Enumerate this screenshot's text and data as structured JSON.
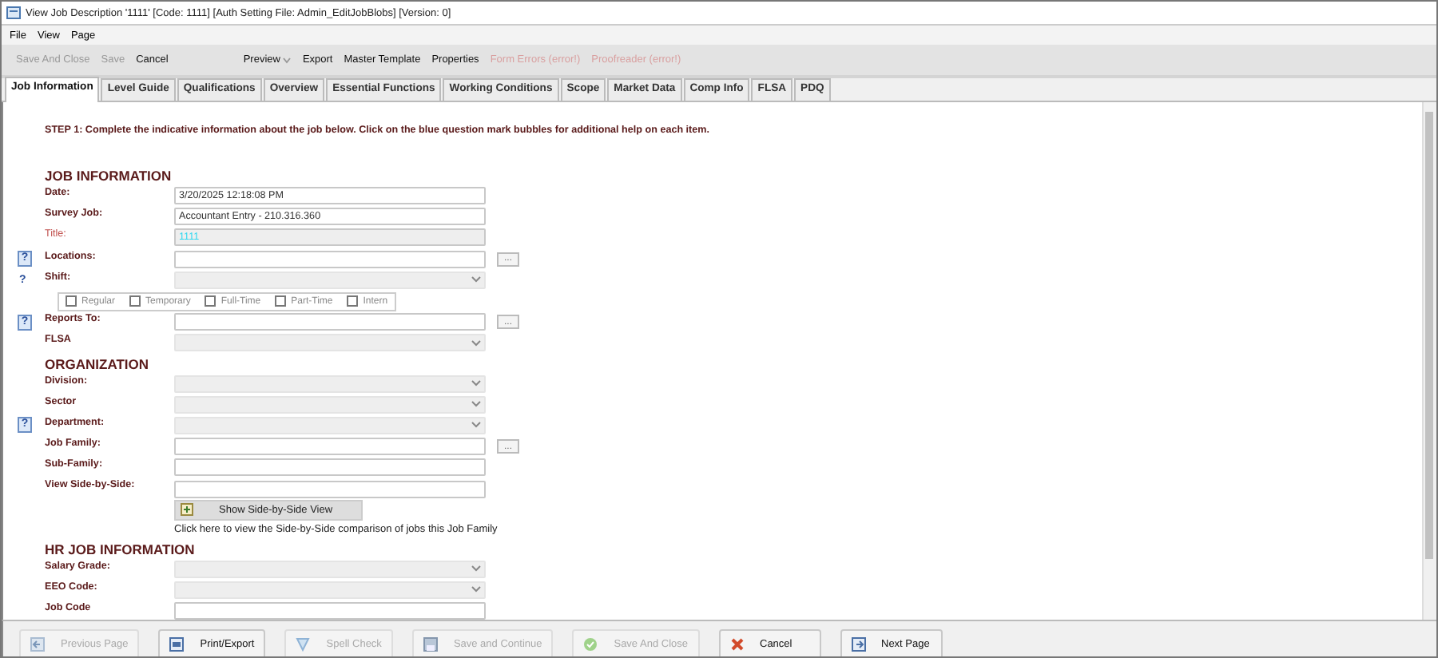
{
  "window": {
    "title": "View Job Description '1111'  [Code: 1111] [Auth Setting File: Admin_EditJobBlobs] [Version: 0]"
  },
  "menu": [
    "File",
    "View",
    "Page"
  ],
  "toolbar": [
    {
      "label": "Save And Close",
      "disabled": true,
      "kind": "plain"
    },
    {
      "label": "Save",
      "disabled": true,
      "kind": "plain"
    },
    {
      "label": "Cancel",
      "disabled": false,
      "kind": "plain"
    },
    {
      "label": "Preview",
      "disabled": false,
      "kind": "dropdown"
    },
    {
      "label": "Export",
      "disabled": false,
      "kind": "plain"
    },
    {
      "label": "Master Template",
      "disabled": false,
      "kind": "plain"
    },
    {
      "label": "Properties",
      "disabled": false,
      "kind": "plain"
    },
    {
      "label": "Form Errors (error!)",
      "disabled": true,
      "kind": "plain"
    },
    {
      "label": "Proofreader (error!)",
      "disabled": true,
      "kind": "plain"
    }
  ],
  "tabs": [
    {
      "label": "Job Information",
      "selected": true
    },
    {
      "label": "Level Guide",
      "selected": false
    },
    {
      "label": "Qualifications",
      "selected": false
    },
    {
      "label": "Overview",
      "selected": false
    },
    {
      "label": "Essential Functions",
      "selected": false
    },
    {
      "label": "Working Conditions",
      "selected": false
    },
    {
      "label": "Scope",
      "selected": false
    },
    {
      "label": "Market Data",
      "selected": false
    },
    {
      "label": "Comp Info",
      "selected": false
    },
    {
      "label": "FLSA",
      "selected": false
    },
    {
      "label": "PDQ",
      "selected": false
    }
  ],
  "instructions": "STEP 1:  Complete the indicative information about the job below.  Click on the blue question mark bubbles for additional help on each item.",
  "sections": [
    {
      "heading": "JOB INFORMATION",
      "rows": [
        {
          "kind": "text",
          "label": "Date:",
          "value": "3/20/2025 12:18:08 PM",
          "required": false
        },
        {
          "kind": "text",
          "label": "Survey Job:",
          "value": "Accountant Entry - 210.316.360",
          "required": false
        },
        {
          "kind": "readonly",
          "label": "Title:",
          "value": "1111",
          "required": true
        },
        {
          "kind": "text",
          "label": "Locations:",
          "help": {
            "kind": "bubble",
            "text": "?"
          },
          "browse": "...",
          "required": false
        },
        {
          "kind": "select",
          "label": "Shift:",
          "help": {
            "kind": "mark",
            "text": "?"
          },
          "required": false
        },
        {
          "kind": "checkboxes",
          "options": [
            {
              "label": "Regular",
              "checked": false
            },
            {
              "label": "Temporary",
              "checked": false
            },
            {
              "label": "Full-Time",
              "checked": false
            },
            {
              "label": "Part-Time",
              "checked": false
            },
            {
              "label": "Intern",
              "checked": false
            }
          ]
        },
        {
          "kind": "text",
          "label": "Reports To:",
          "help": {
            "kind": "bubble",
            "text": "?"
          },
          "browse": "...",
          "required": false
        },
        {
          "kind": "select",
          "label": "FLSA",
          "required": false
        }
      ]
    },
    {
      "heading": "ORGANIZATION",
      "rows": [
        {
          "kind": "select",
          "label": "Division:",
          "required": false
        },
        {
          "kind": "select",
          "label": "Sector",
          "required": false
        },
        {
          "kind": "select",
          "label": "Department:",
          "help": {
            "kind": "bubble",
            "text": "?"
          },
          "required": false
        },
        {
          "kind": "text",
          "label": "Job Family:",
          "browse": "...",
          "required": false
        },
        {
          "kind": "text",
          "label": "Sub-Family:",
          "required": false
        },
        {
          "kind": "text",
          "label": "View Side-by-Side:",
          "required": false
        },
        {
          "kind": "action",
          "button": "Show Side-by-Side View",
          "note": "Click here to view the Side-by-Side comparison of jobs this Job Family"
        }
      ]
    },
    {
      "heading": "HR JOB INFORMATION",
      "rows": [
        {
          "kind": "select",
          "label": "Salary Grade:",
          "required": false
        },
        {
          "kind": "select",
          "label": "EEO Code:",
          "required": false
        },
        {
          "kind": "text",
          "label": "Job Code",
          "required": false
        }
      ]
    }
  ],
  "footer": [
    {
      "label": "Previous Page",
      "disabled": true
    },
    {
      "label": "Print/Export",
      "disabled": false
    },
    {
      "label": "Spell Check",
      "disabled": true
    },
    {
      "label": "Save and Continue",
      "disabled": true
    },
    {
      "label": "Save And Close",
      "disabled": true
    },
    {
      "label": "Cancel",
      "disabled": false
    },
    {
      "label": "Next Page",
      "disabled": false
    }
  ]
}
